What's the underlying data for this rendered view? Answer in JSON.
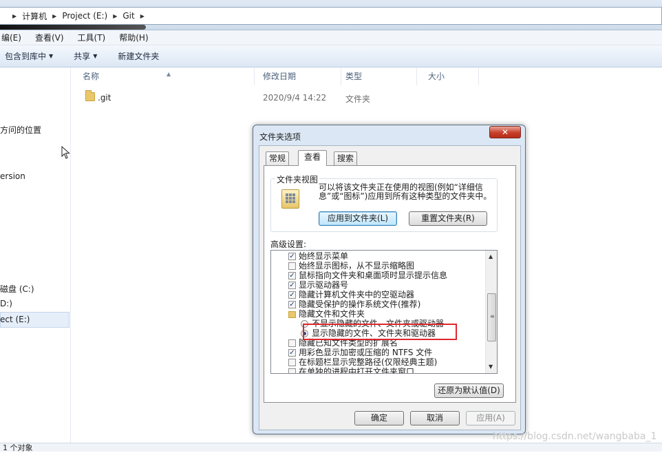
{
  "explorer": {
    "breadcrumb": [
      "计算机",
      "Project (E:)",
      "Git"
    ],
    "menu": [
      "编(E)",
      "查看(V)",
      "工具(T)",
      "帮助(H)"
    ],
    "toolbar": {
      "include_library": "包含到库中",
      "share": "共享",
      "new_folder": "新建文件夹"
    },
    "columns": [
      "名称",
      "修改日期",
      "类型",
      "大小"
    ],
    "files": [
      {
        "name": ".git",
        "modified": "2020/9/4 14:22",
        "type": "文件夹",
        "size": ""
      }
    ],
    "nav": {
      "recent_places": "方问的位置",
      "version": "ersion",
      "drive_c": "磁盘 (C:)",
      "drive_d": "D:)",
      "drive_e": "ect (E:)"
    },
    "status": "1 个对象"
  },
  "dialog": {
    "title": "文件夹选项",
    "close_glyph": "✕",
    "tabs": [
      "常规",
      "查看",
      "搜索"
    ],
    "active_tab": "查看",
    "folder_views": {
      "legend": "文件夹视图",
      "description": "可以将该文件夹正在使用的视图(例如“详细信息”或“图标”)应用到所有这种类型的文件夹中。",
      "apply_button": "应用到文件夹(L)",
      "reset_button": "重置文件夹(R)"
    },
    "advanced_label": "高级设置:",
    "advanced_items": [
      {
        "kind": "checkbox",
        "checked": true,
        "label": "始终显示菜单"
      },
      {
        "kind": "checkbox",
        "checked": false,
        "label": "始终显示图标，从不显示缩略图"
      },
      {
        "kind": "checkbox",
        "checked": true,
        "label": "鼠标指向文件夹和桌面项时显示提示信息"
      },
      {
        "kind": "checkbox",
        "checked": true,
        "label": "显示驱动器号"
      },
      {
        "kind": "checkbox",
        "checked": true,
        "label": "隐藏计算机文件夹中的空驱动器"
      },
      {
        "kind": "checkbox",
        "checked": true,
        "label": "隐藏受保护的操作系统文件(推荐)"
      },
      {
        "kind": "folder",
        "label": "隐藏文件和文件夹"
      },
      {
        "kind": "radio",
        "checked": false,
        "label": "不显示隐藏的文件、文件夹或驱动器"
      },
      {
        "kind": "radio",
        "checked": true,
        "label": "显示隐藏的文件、文件夹和驱动器"
      },
      {
        "kind": "checkbox",
        "checked": false,
        "label": "隐藏已知文件类型的扩展名"
      },
      {
        "kind": "checkbox",
        "checked": true,
        "label": "用彩色显示加密或压缩的 NTFS 文件"
      },
      {
        "kind": "checkbox",
        "checked": false,
        "label": "在标题栏显示完整路径(仅限经典主题)"
      },
      {
        "kind": "checkbox",
        "checked": false,
        "label": "在单独的进程中打开文件夹窗口"
      }
    ],
    "restore_defaults": "还原为默认值(D)",
    "ok": "确定",
    "cancel": "取消",
    "apply": "应用(A)"
  },
  "watermark": "https://blog.csdn.net/wangbaba_1",
  "colors": {
    "highlight": "#e0262b",
    "dialog_frame": "#dbe7f4"
  }
}
